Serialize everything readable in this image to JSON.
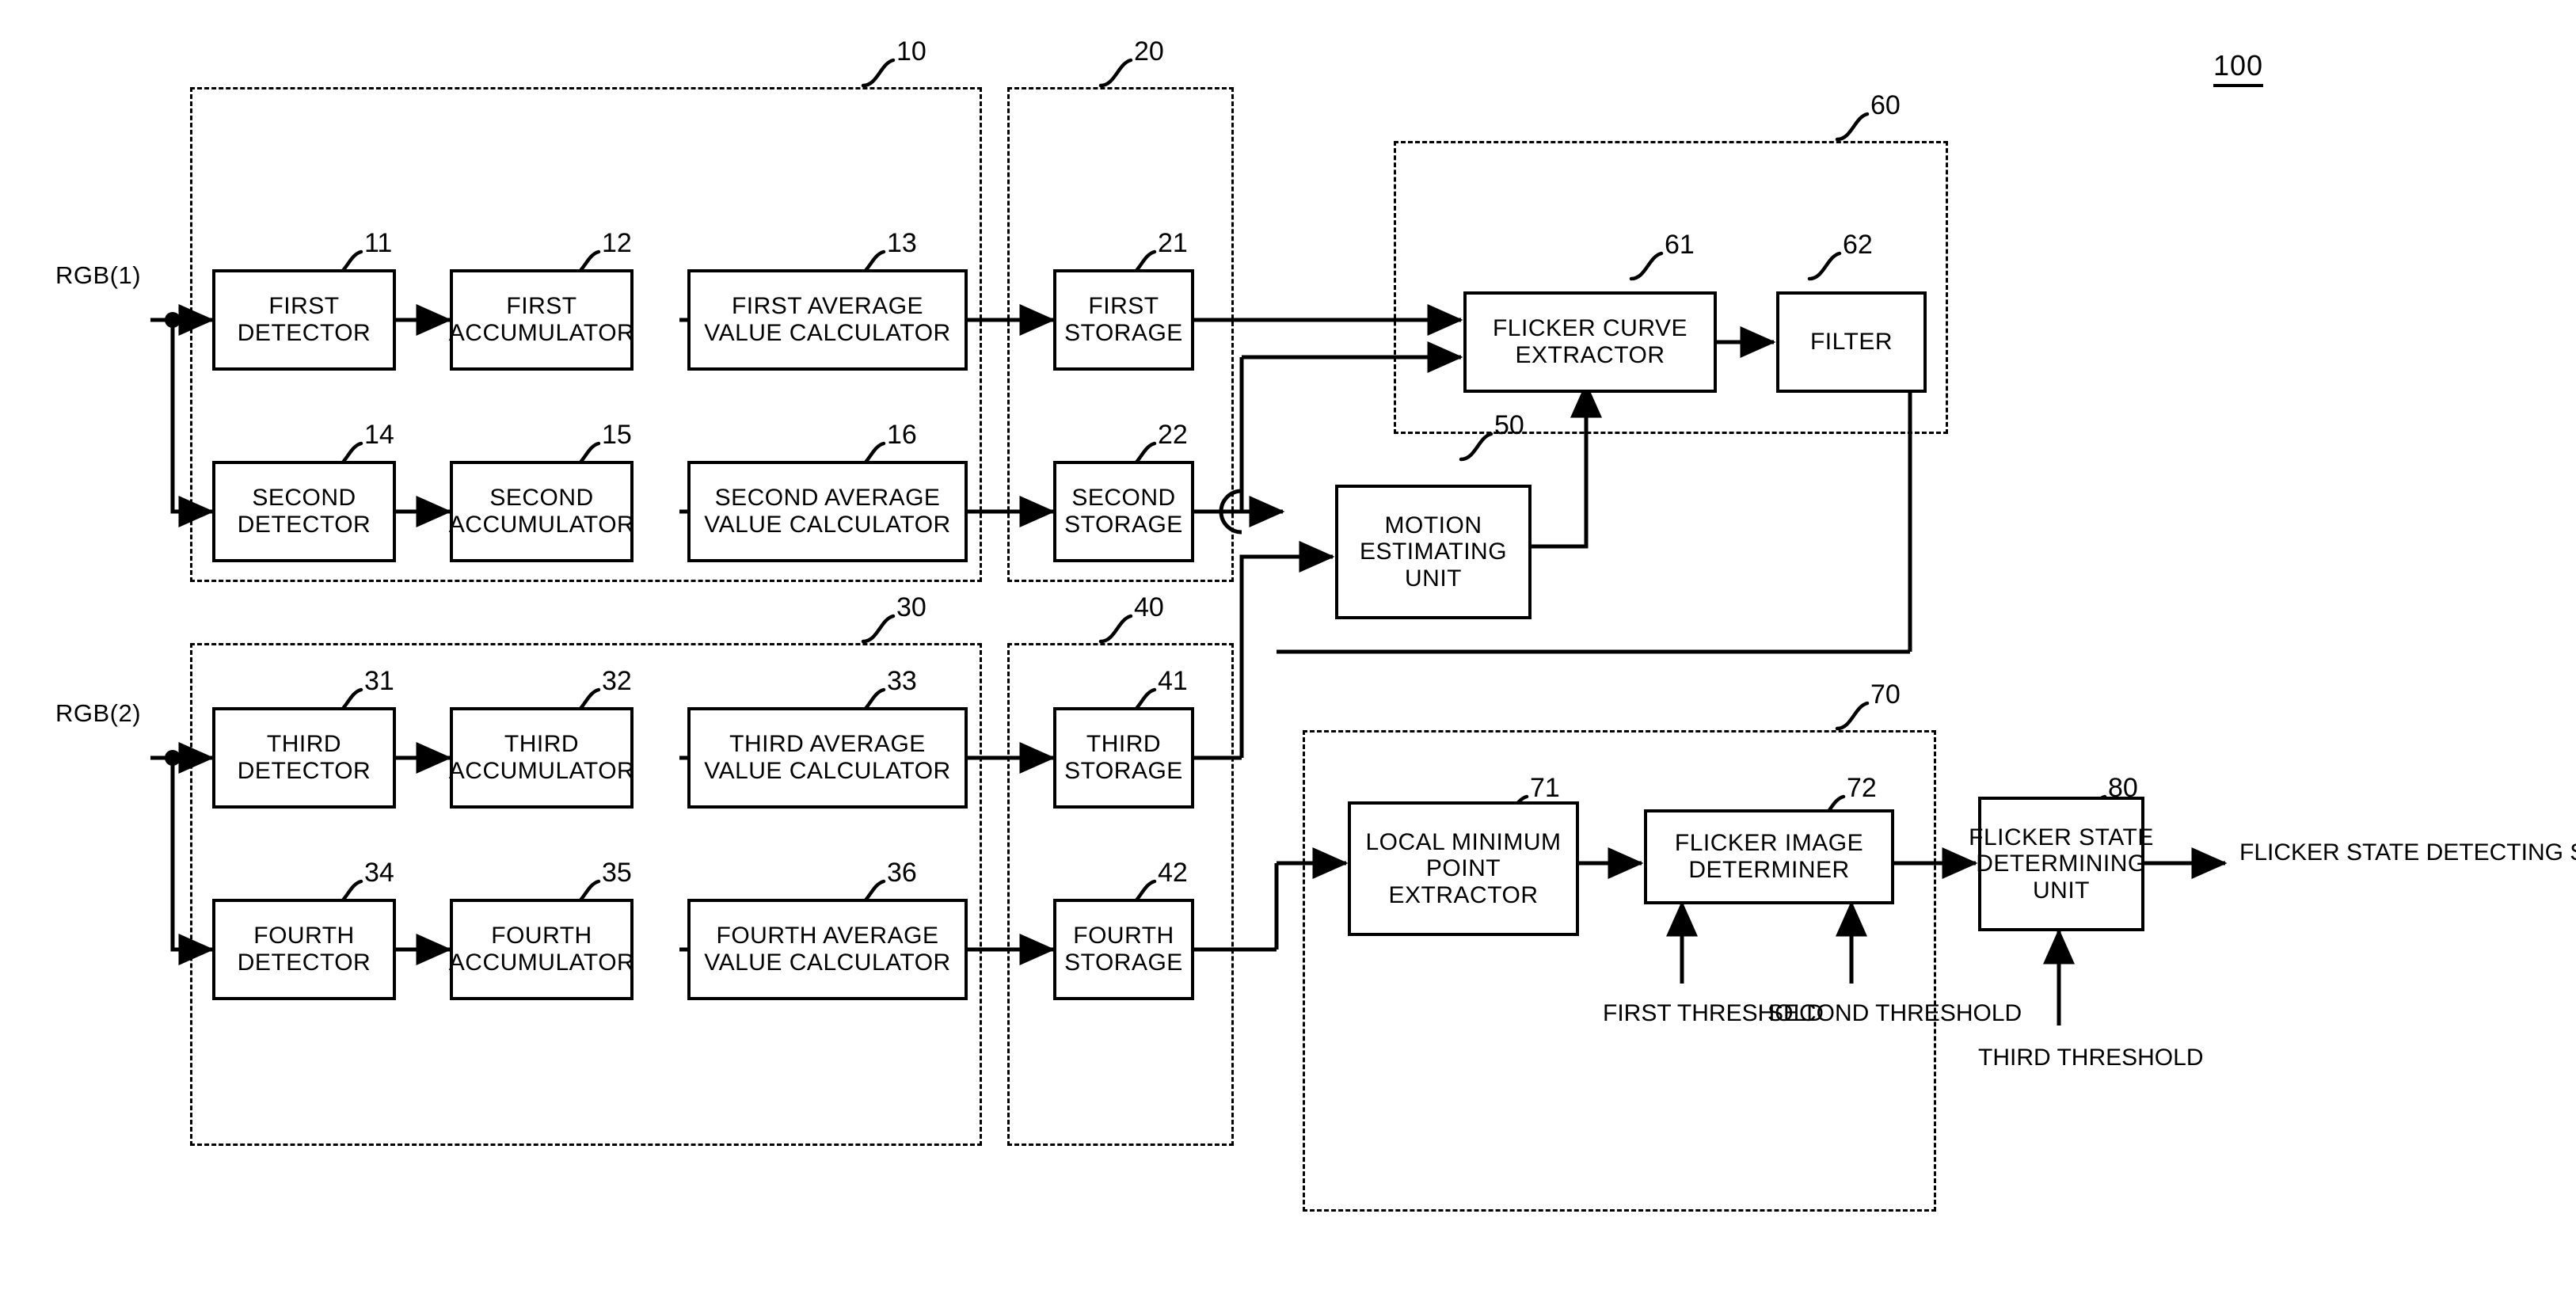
{
  "figure": {
    "system_ref": "100",
    "inputs": [
      {
        "label": "RGB(1)"
      },
      {
        "label": "RGB(2)"
      }
    ],
    "output": {
      "line1": "FLICKER STATE",
      "line2": "DETECTING SIGNAL"
    }
  },
  "groups": [
    {
      "ref": "10"
    },
    {
      "ref": "20"
    },
    {
      "ref": "30"
    },
    {
      "ref": "40"
    },
    {
      "ref": "60"
    },
    {
      "ref": "70"
    }
  ],
  "blocks": [
    {
      "ref": "11",
      "line1": "FIRST",
      "line2": "DETECTOR",
      "line3": ""
    },
    {
      "ref": "12",
      "line1": "FIRST",
      "line2": "ACCUMULATOR",
      "line3": ""
    },
    {
      "ref": "13",
      "line1": "FIRST AVERAGE",
      "line2": "VALUE CALCULATOR",
      "line3": ""
    },
    {
      "ref": "21",
      "line1": "FIRST",
      "line2": "STORAGE",
      "line3": ""
    },
    {
      "ref": "14",
      "line1": "SECOND",
      "line2": "DETECTOR",
      "line3": ""
    },
    {
      "ref": "15",
      "line1": "SECOND",
      "line2": "ACCUMULATOR",
      "line3": ""
    },
    {
      "ref": "16",
      "line1": "SECOND AVERAGE",
      "line2": "VALUE CALCULATOR",
      "line3": ""
    },
    {
      "ref": "22",
      "line1": "SECOND",
      "line2": "STORAGE",
      "line3": ""
    },
    {
      "ref": "31",
      "line1": "THIRD",
      "line2": "DETECTOR",
      "line3": ""
    },
    {
      "ref": "32",
      "line1": "THIRD",
      "line2": "ACCUMULATOR",
      "line3": ""
    },
    {
      "ref": "33",
      "line1": "THIRD AVERAGE",
      "line2": "VALUE CALCULATOR",
      "line3": ""
    },
    {
      "ref": "41",
      "line1": "THIRD",
      "line2": "STORAGE",
      "line3": ""
    },
    {
      "ref": "34",
      "line1": "FOURTH",
      "line2": "DETECTOR",
      "line3": ""
    },
    {
      "ref": "35",
      "line1": "FOURTH",
      "line2": "ACCUMULATOR",
      "line3": ""
    },
    {
      "ref": "36",
      "line1": "FOURTH AVERAGE",
      "line2": "VALUE CALCULATOR",
      "line3": ""
    },
    {
      "ref": "42",
      "line1": "FOURTH",
      "line2": "STORAGE",
      "line3": ""
    },
    {
      "ref": "61",
      "line1": "FLICKER CURVE",
      "line2": "EXTRACTOR",
      "line3": ""
    },
    {
      "ref": "62",
      "line1": "FILTER",
      "line2": "",
      "line3": ""
    },
    {
      "ref": "50",
      "line1": "MOTION",
      "line2": "ESTIMATING",
      "line3": "UNIT"
    },
    {
      "ref": "71",
      "line1": "LOCAL MINIMUM",
      "line2": "POINT",
      "line3": "EXTRACTOR"
    },
    {
      "ref": "72",
      "line1": "FLICKER IMAGE",
      "line2": "DETERMINER",
      "line3": ""
    },
    {
      "ref": "80",
      "line1": "FLICKER STATE",
      "line2": "DETERMINING",
      "line3": "UNIT"
    }
  ],
  "thresholds": [
    {
      "line1": "FIRST",
      "line2": "THRESHOLD"
    },
    {
      "line1": "SECOND",
      "line2": "THRESHOLD"
    },
    {
      "line1": "THIRD",
      "line2": "THRESHOLD"
    }
  ]
}
